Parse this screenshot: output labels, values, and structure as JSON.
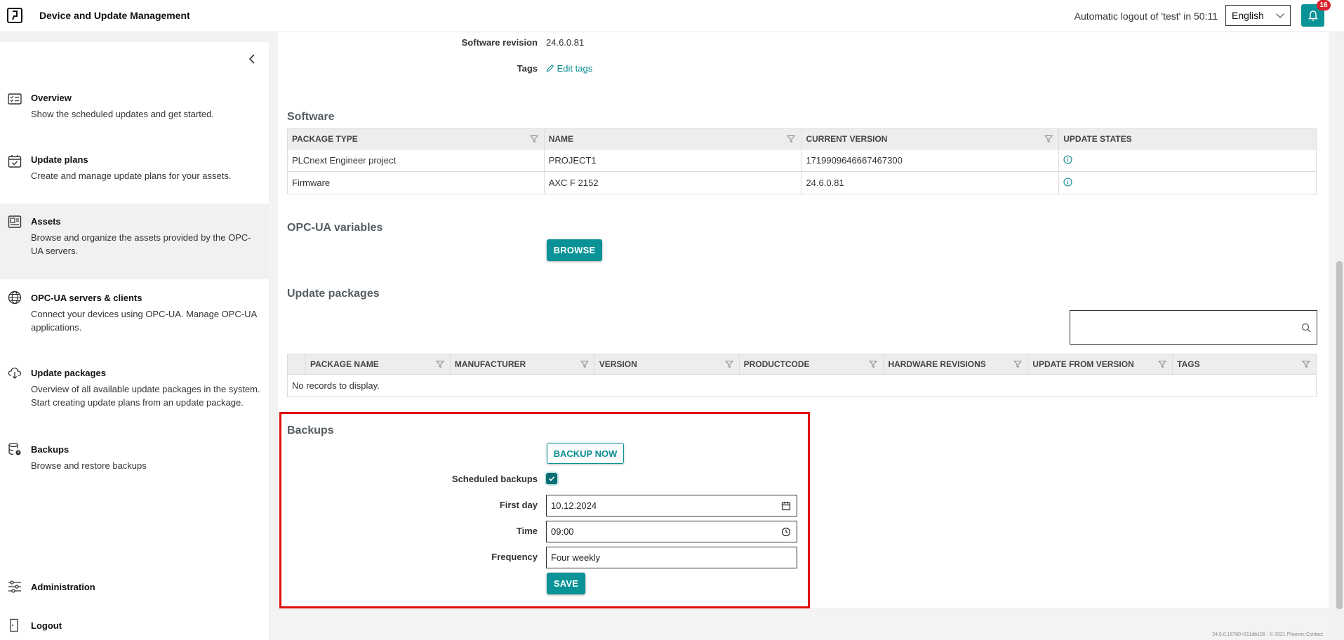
{
  "header": {
    "app_title": "Device and Update Management",
    "logout_notice": "Automatic logout of 'test' in 50:11",
    "language": "English",
    "notification_count": "16"
  },
  "sidebar": {
    "items": [
      {
        "title": "Overview",
        "desc": "Show the scheduled updates and get started.",
        "icon": "checklist-icon"
      },
      {
        "title": "Update plans",
        "desc": "Create and manage update plans for your assets.",
        "icon": "calendar-check-icon"
      },
      {
        "title": "Assets",
        "desc": "Browse and organize the assets provided by the OPC-UA servers.",
        "icon": "asset-card-icon"
      },
      {
        "title": "OPC-UA servers & clients",
        "desc": "Connect your devices using OPC-UA. Manage OPC-UA applications.",
        "icon": "globe-icon"
      },
      {
        "title": "Update packages",
        "desc": "Overview of all available update packages in the system. Start creating update plans from an update package.",
        "icon": "cloud-download-icon"
      },
      {
        "title": "Backups",
        "desc": "Browse and restore backups",
        "icon": "database-backup-icon"
      }
    ],
    "administration": "Administration",
    "logout": "Logout"
  },
  "details": {
    "software_revision_label": "Software revision",
    "software_revision_value": "24.6.0.81",
    "tags_label": "Tags",
    "edit_tags": "Edit tags"
  },
  "software": {
    "title": "Software",
    "columns": [
      "PACKAGE TYPE",
      "NAME",
      "CURRENT VERSION",
      "UPDATE STATES"
    ],
    "rows": [
      [
        "PLCnext Engineer project",
        "PROJECT1",
        "1719909646667467300"
      ],
      [
        "Firmware",
        "AXC F 2152",
        "24.6.0.81"
      ]
    ]
  },
  "opcua": {
    "title": "OPC-UA variables",
    "browse_label": "BROWSE"
  },
  "packages": {
    "title": "Update packages",
    "search_placeholder": "",
    "columns": [
      "PACKAGE NAME",
      "MANUFACTURER",
      "VERSION",
      "PRODUCTCODE",
      "HARDWARE REVISIONS",
      "UPDATE FROM VERSION",
      "TAGS"
    ],
    "empty_text": "No records to display."
  },
  "backups": {
    "title": "Backups",
    "backup_now_label": "BACKUP NOW",
    "scheduled_label": "Scheduled backups",
    "scheduled_checked": true,
    "first_day_label": "First day",
    "first_day_value": "10.12.2024",
    "time_label": "Time",
    "time_value": "09:00",
    "frequency_label": "Frequency",
    "frequency_value": "Four weekly",
    "save_label": "SAVE"
  },
  "footer": {
    "version": "24.9.0.16780+911db108 - © 2021 Phoenix Contact"
  },
  "colors": {
    "accent": "#0a9396",
    "highlight": "#e01010",
    "badge": "#d9232d"
  }
}
